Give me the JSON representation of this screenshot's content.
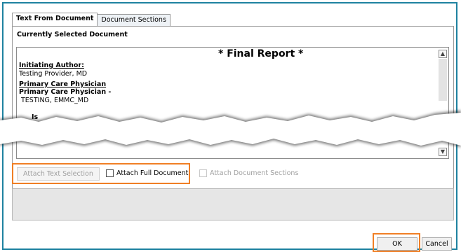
{
  "tabs": [
    {
      "label": "Text From Document",
      "active": true
    },
    {
      "label": "Document Sections",
      "active": false
    }
  ],
  "section_label": "Currently Selected Document",
  "document": {
    "title": "* Final Report *",
    "lines": [
      "Initiating Author:",
      "Testing Provider, MD",
      "Primary Care Physician",
      "Primary Care Physician -",
      "TESTING, EMMC_MD",
      "Is"
    ]
  },
  "icons": {
    "scroll_up": "▲",
    "scroll_down": "▼"
  },
  "actions": {
    "attach_text_selection": "Attach Text Selection",
    "attach_full_document": "Attach Full Document",
    "attach_document_sections": "Attach Document Sections"
  },
  "footer": {
    "ok": "OK",
    "cancel": "Cancel"
  },
  "colors": {
    "frame_border": "#1e82a0",
    "highlight": "#f07f25"
  }
}
